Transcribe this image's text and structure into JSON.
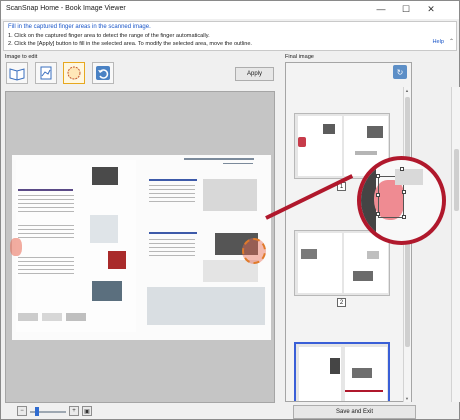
{
  "window": {
    "title": "ScanSnap Home - Book Image Viewer",
    "controls": {
      "minimize": "—",
      "maximize": "☐",
      "close": "✕"
    }
  },
  "instructions": {
    "heading": "Fill in the captured finger areas in the scanned image.",
    "step1": "1. Click on the captured finger area to detect the range of the finger automatically.",
    "step2": "2. Click the [Apply] button to fill in the selected area. To modify the selected area, move the outline.",
    "help": "Help",
    "collapse": "⌃"
  },
  "editor": {
    "label": "Image to edit",
    "apply_label": "Apply",
    "tools": [
      {
        "name": "book-spread-icon",
        "label": ""
      },
      {
        "name": "page-adjust-icon",
        "label": ""
      },
      {
        "name": "finger-area-icon",
        "label": ""
      },
      {
        "name": "undo-icon",
        "label": ""
      }
    ],
    "zoom": {
      "level_percent": 20
    }
  },
  "final": {
    "label": "Final image",
    "pages": [
      "1",
      "2"
    ],
    "save_label": "Save and Exit"
  },
  "colors": {
    "accent": "#1a56c8",
    "selection_border": "#3a5fd7",
    "highlight_red": "#b0182c"
  }
}
